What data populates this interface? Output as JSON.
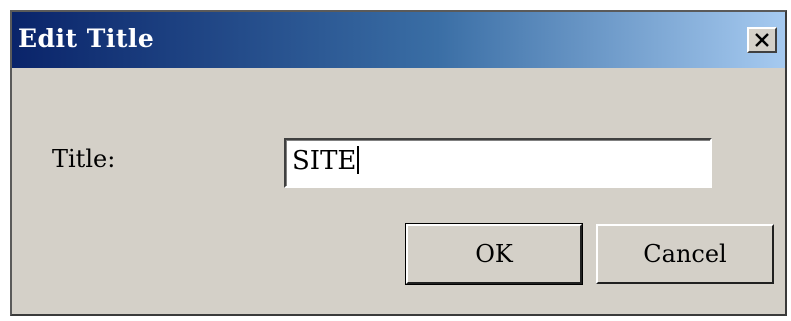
{
  "window": {
    "title": "Edit Title",
    "close_symbol": "×",
    "close_icon": "close-icon"
  },
  "form": {
    "label": "Title:",
    "value": "SITE"
  },
  "buttons": {
    "ok_label": "OK",
    "cancel_label": "Cancel"
  },
  "colors": {
    "titlebar_start": "#0a246a",
    "titlebar_end": "#a6caf0",
    "dialog_face": "#d4d0c8"
  }
}
